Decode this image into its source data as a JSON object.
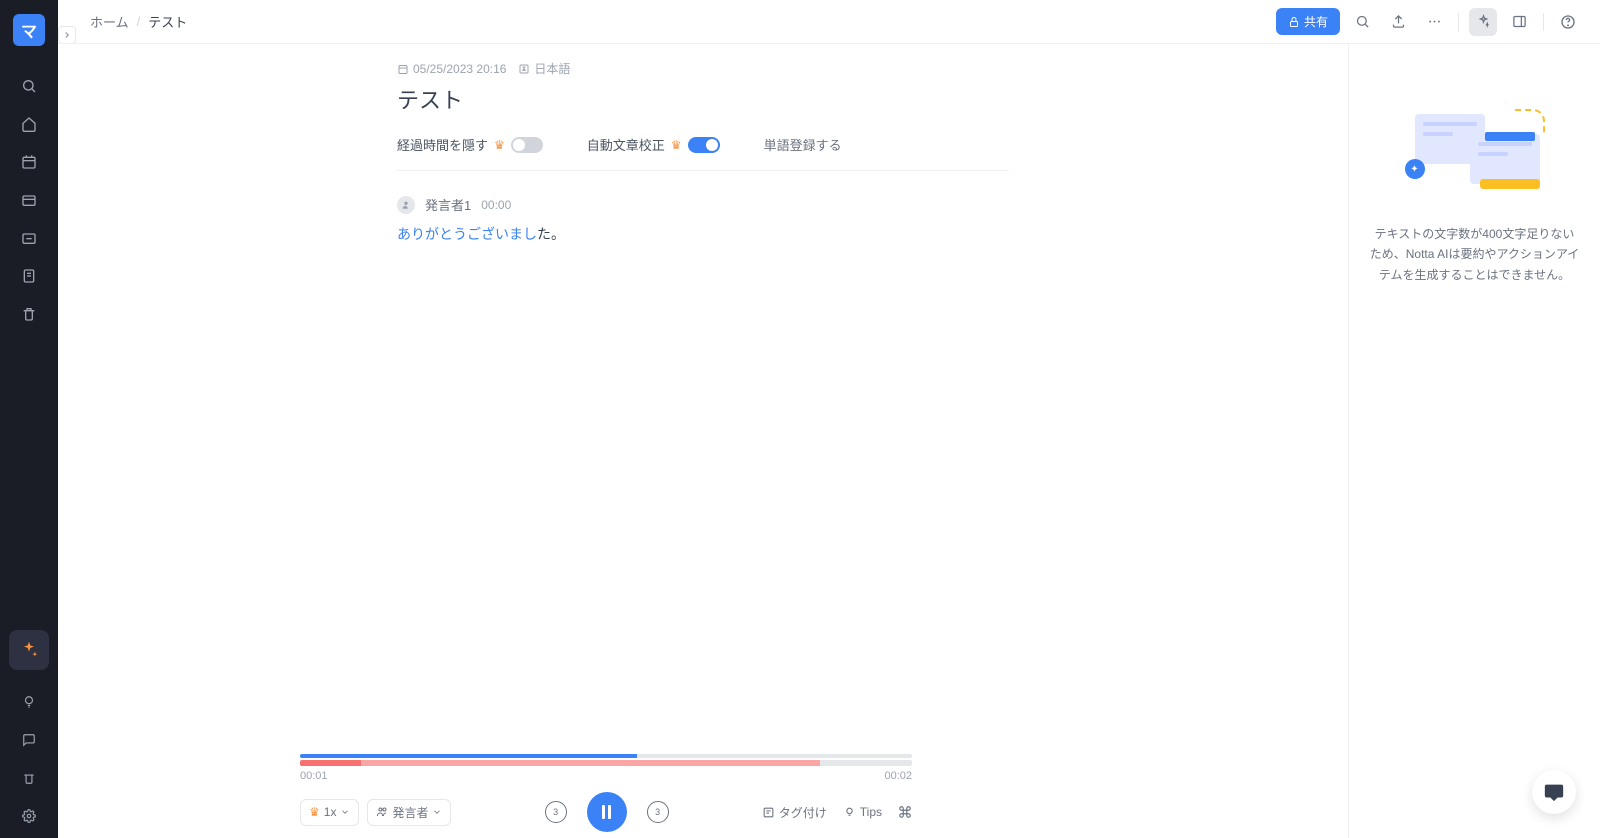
{
  "sidebar": {
    "logo_text": "マ"
  },
  "header": {
    "breadcrumb_home": "ホーム",
    "breadcrumb_current": "テスト",
    "share_label": "共有"
  },
  "meta": {
    "datetime": "05/25/2023 20:16",
    "language": "日本語"
  },
  "title": "テスト",
  "options": {
    "hide_elapsed": "経過時間を隠す",
    "auto_proofread": "自動文章校正",
    "register_words": "単語登録する"
  },
  "transcript": {
    "speaker": "発言者1",
    "timestamp": "00:00",
    "highlighted": "ありがとうございまし",
    "rest": "た。"
  },
  "right_panel": {
    "message": "テキストの文字数が400文字足りないため、Notta AIは要約やアクションアイテムを生成することはできません。"
  },
  "player": {
    "current_time": "00:01",
    "total_time": "00:02",
    "speed": "1x",
    "speaker_label": "発言者",
    "skip_seconds": "3",
    "tag_label": "タグ付け",
    "tips_label": "Tips"
  }
}
